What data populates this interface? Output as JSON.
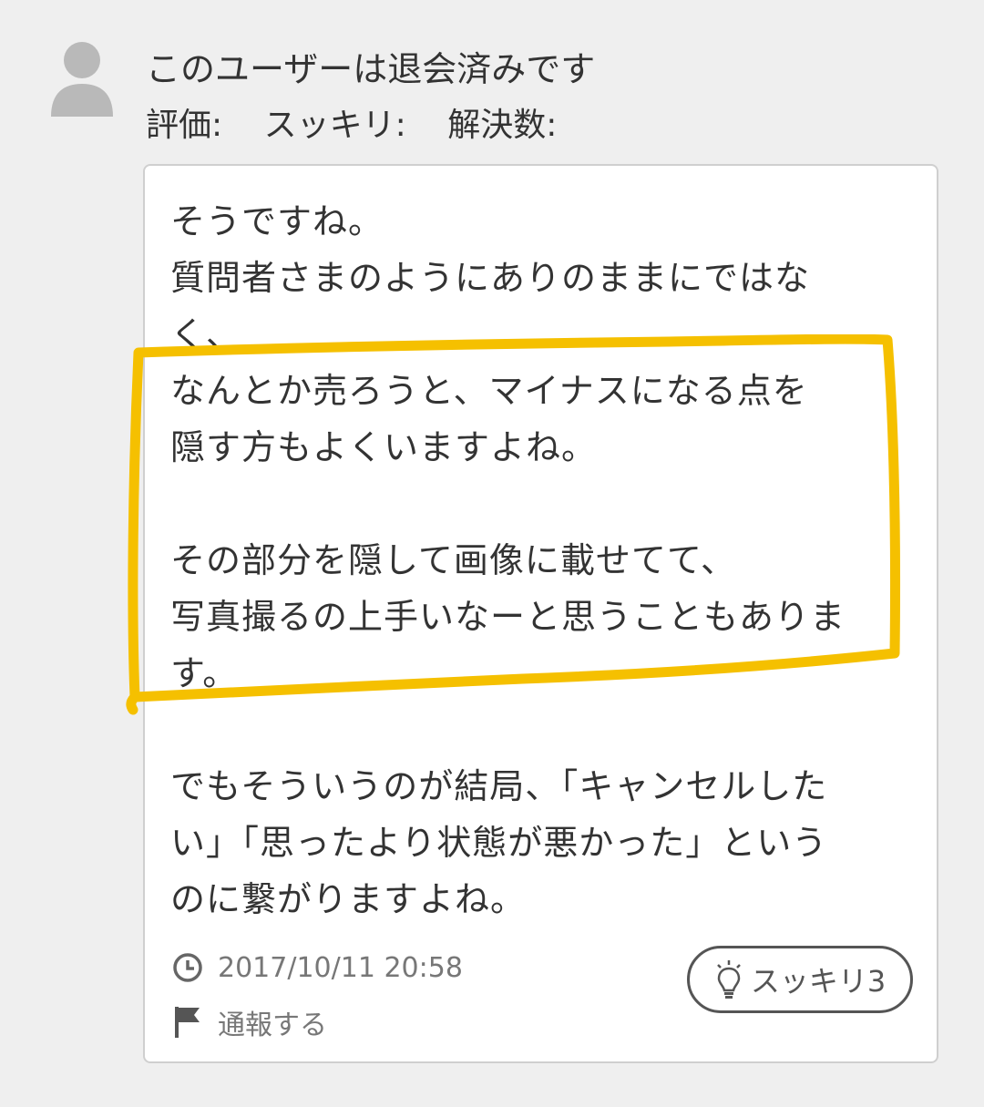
{
  "user": {
    "name": "このユーザーは退会済みです",
    "stats": [
      "評価:",
      "スッキリ:",
      "解決数:"
    ]
  },
  "answer": {
    "lines": [
      "そうですね。",
      "質問者さまのようにありのままにではな",
      "く、",
      "なんとか売ろうと、マイナスになる点を",
      "隠す方もよくいますよね。",
      "その部分を隠して画像に載せてて、",
      "写真撮るの上手いなーと思うこともありま",
      "す。",
      "でもそういうのが結局、「キャンセルした",
      "い」「思ったより状態が悪かった」という",
      "のに繋がりますよね。"
    ],
    "timestamp": "2017/10/11 20:58",
    "report_label": "通報する",
    "sukkiri_label": "スッキリ3"
  },
  "colors": {
    "highlight": "#f5c000",
    "text": "#333333",
    "meta": "#777777"
  },
  "icons": [
    "avatar-icon",
    "clock-icon",
    "flag-icon",
    "lightbulb-icon"
  ]
}
